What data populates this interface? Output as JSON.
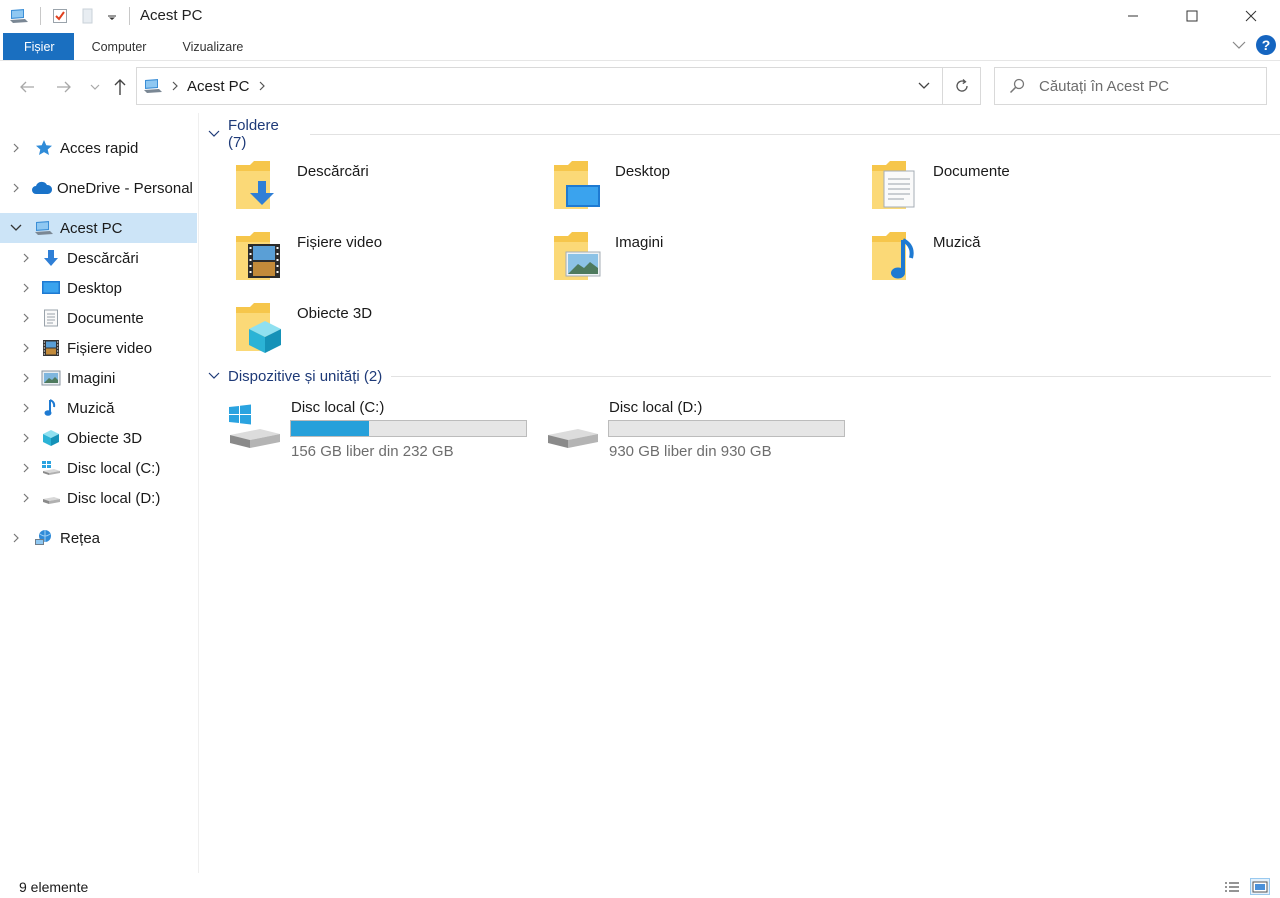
{
  "window": {
    "title": "Acest PC",
    "controls": {
      "minimize_icon": "minimize-icon",
      "maximize_icon": "maximize-icon",
      "close_icon": "close-icon"
    }
  },
  "ribbon": {
    "tabs": [
      {
        "label": "Fișier",
        "active": true
      },
      {
        "label": "Computer",
        "active": false
      },
      {
        "label": "Vizualizare",
        "active": false
      }
    ],
    "help_label": "?"
  },
  "address": {
    "crumbs": [
      "Acest PC"
    ],
    "search_placeholder": "Căutați în Acest PC"
  },
  "nav": {
    "items": [
      {
        "label": "Acces rapid",
        "icon": "star-icon"
      },
      {
        "label": "OneDrive - Personal",
        "icon": "cloud-icon"
      },
      {
        "label": "Acest PC",
        "icon": "computer-icon",
        "selected": true
      },
      {
        "label": "Descărcări",
        "icon": "download-icon"
      },
      {
        "label": "Desktop",
        "icon": "desktop-icon"
      },
      {
        "label": "Documente",
        "icon": "document-icon"
      },
      {
        "label": "Fișiere video",
        "icon": "video-icon"
      },
      {
        "label": "Imagini",
        "icon": "image-icon"
      },
      {
        "label": "Muzică",
        "icon": "music-icon"
      },
      {
        "label": "Obiecte 3D",
        "icon": "cube-icon"
      },
      {
        "label": "Disc local (C:)",
        "icon": "drive-c-icon"
      },
      {
        "label": "Disc local (D:)",
        "icon": "drive-d-icon"
      },
      {
        "label": "Rețea",
        "icon": "network-icon"
      }
    ]
  },
  "content": {
    "folders_header": "Foldere (7)",
    "folders": [
      {
        "label": "Descărcări",
        "icon": "downloads-folder-icon"
      },
      {
        "label": "Desktop",
        "icon": "desktop-folder-icon"
      },
      {
        "label": "Documente",
        "icon": "documents-folder-icon"
      },
      {
        "label": "Fișiere video",
        "icon": "videos-folder-icon"
      },
      {
        "label": "Imagini",
        "icon": "pictures-folder-icon"
      },
      {
        "label": "Muzică",
        "icon": "music-folder-icon"
      },
      {
        "label": "Obiecte 3D",
        "icon": "3d-objects-folder-icon"
      }
    ],
    "devices_header": "Dispozitive și unități (2)",
    "drives": [
      {
        "label": "Disc local (C:)",
        "free_text": "156 GB liber din 232 GB",
        "used_fraction": 0.33,
        "icon": "windows-drive-icon"
      },
      {
        "label": "Disc local (D:)",
        "free_text": "930 GB liber din 930 GB",
        "used_fraction": 0.0,
        "icon": "drive-icon"
      }
    ]
  },
  "status": {
    "count_text": "9 elemente"
  },
  "colors": {
    "accent": "#1a6fc0",
    "selection": "#cce4f7",
    "drive_bar_fill": "#26a0da",
    "group_header": "#1e3a78"
  }
}
